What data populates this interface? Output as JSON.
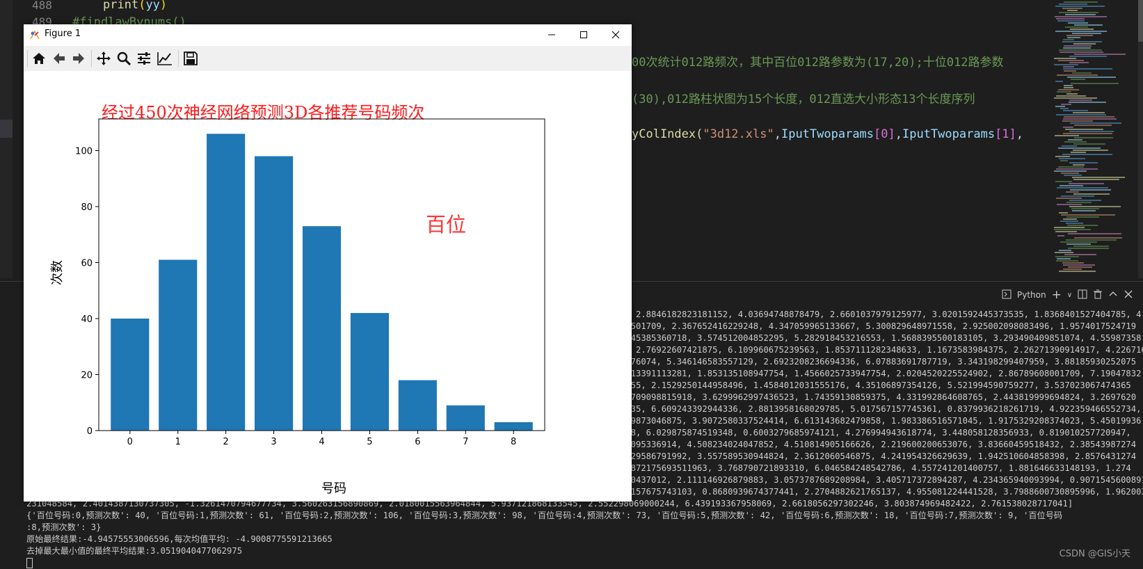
{
  "editor": {
    "line_numbers": [
      "488",
      "489"
    ],
    "line_488": {
      "fn": "print",
      "open": "(",
      "arg": "yy",
      "close": ")"
    },
    "line_489_comment": "#findlawBynums()",
    "comment_a": "00次统计012路频次，其中百位012路参数为(17,20);十位012路参数",
    "comment_b": "(30),012路柱状图为15个长度，012直选大小形态13个长度序列",
    "call_line": {
      "prefix": "yColIndex(",
      "str": "\"3d12.xls\"",
      "comma1": ",",
      "arg1": "IputTwoparams",
      "idx0": "[0]",
      "comma2": ",",
      "arg2": "IputTwoparams",
      "idx1": "[1]",
      "tail": ","
    }
  },
  "terminal": {
    "toolbar": {
      "kind_label": "Python",
      "plus": "+",
      "chevron": "∨"
    },
    "partial_lines": [
      "3, 2.8846182823181152, 4.03694748878479, 2.6601037979125977, 3.0201592445373535, 1.8368401527404785, 4",
      "70501709, 2.367652416229248, 4.347059965133667, 5.300829648971558, 2.925002098083496, 1.9574017524719",
      "0045385360718, 3.574512004852295, 5.282918453216553, 1.5688395500183105, 3.293490409851074, 4.55987358",
      "e, 2.76922607421875, 6.109960675239563, 1.8537111282348633, 1.1673583984375, 2.26271390914917, 4.226716",
      "9476074, 5.346146583557129, 2.6923208236694336, 6.07883691787719, 3.343198299407959, 3.88185930252075",
      "2413391113281, 1.853135108947754, 1.4566025733947754, 2.0204520225524902, 2.86789608001709, 7.19047832",
      "4055, 2.1529250144958496, 1.4584012031555176, 4.35106897354126, 5.521994590759277, 3.537023067474365",
      "56709098815918, 3.6299962997436523, 1.74359130859375, 4.331992864608765, 2.443819999694824, 3.2697620",
      "1035, 6.609243392944336, 2.8813958168029785, 5.017567157745361, 0.8379936218261719, 4.922359466552734,",
      "119873046875, 3.9072580337524414, 6.613143682479858, 1.983386516571045, 1.9175329208374023, 5.45019936",
      "098, 6.029875874519348, 0.6003279685974121, 4.276994943618774, 3.448058128356933, 0.819010257720947,",
      "82095336914, 4.508234024047852, 4.510814905166626, 2.219600200653076, 3.83660459518432, 2.38543987274",
      "8529586791992, 3.557589530944824, 2.3612060546875, 4.241954326629639, 1.942510604858398, 2.8576431274",
      "1.872175693511963, 3.768790721893310, 6.046584248542786, 4.557241201400757, 1.881646633148193, 1.274",
      "260437012, 2.111146926879883, 3.0573787689208984, 3.405717372894287, 4.234365940093994, 0.9071545600891",
      "00157675743103, 0.8680939674377441, 2.2704882621765137, 4.955081224441528, 3.7988600730895996, 1.962003"
    ],
    "full_lines": [
      "231048584, 2.4014387130737305, -1.3261470794677734, 3.560263156890869, 2.0180015563964844, 5.937121868133545, 2.552298069000244, 6.439193367958069, 2.6618056297302246, 3.803874969482422, 2.761538028717041]",
      "{'百位号码:0,预测次数': 40, '百位号码:1,预测次数': 61, '百位号码:2,预测次数': 106, '百位号码:3,预测次数': 98, '百位号码:4,预测次数': 73, '百位号码:5,预测次数': 42, '百位号码:6,预测次数': 18, '百位号码:7,预测次数': 9, '百位号码",
      ":8,预测次数': 3}",
      "原始最终结果:-4.94575553006596,每次均值平均: -4.9008775591213665",
      "去掉最大最小值的最终平均结果:3.0519040477062975"
    ],
    "watermark": "CSDN @GIS小天"
  },
  "figure": {
    "window_title": "Figure 1",
    "toolbar_icons": [
      "home-icon",
      "back-icon",
      "forward-icon",
      "pan-icon",
      "zoom-icon",
      "configure-subplots-icon",
      "edit-axis-icon",
      "save-icon"
    ]
  },
  "chart_data": {
    "type": "bar",
    "title": "经过450次神经网络预测3D各推荐号码频次",
    "xlabel": "号码",
    "ylabel": "次数",
    "annotation": "百位",
    "categories": [
      "0",
      "1",
      "2",
      "3",
      "4",
      "5",
      "6",
      "7",
      "8"
    ],
    "values": [
      40,
      61,
      106,
      98,
      73,
      42,
      18,
      9,
      3
    ],
    "ylim": [
      0,
      111.3
    ],
    "yticks": [
      0,
      20,
      40,
      60,
      80,
      100
    ],
    "bar_color": "#1f77b4",
    "grid": false
  }
}
